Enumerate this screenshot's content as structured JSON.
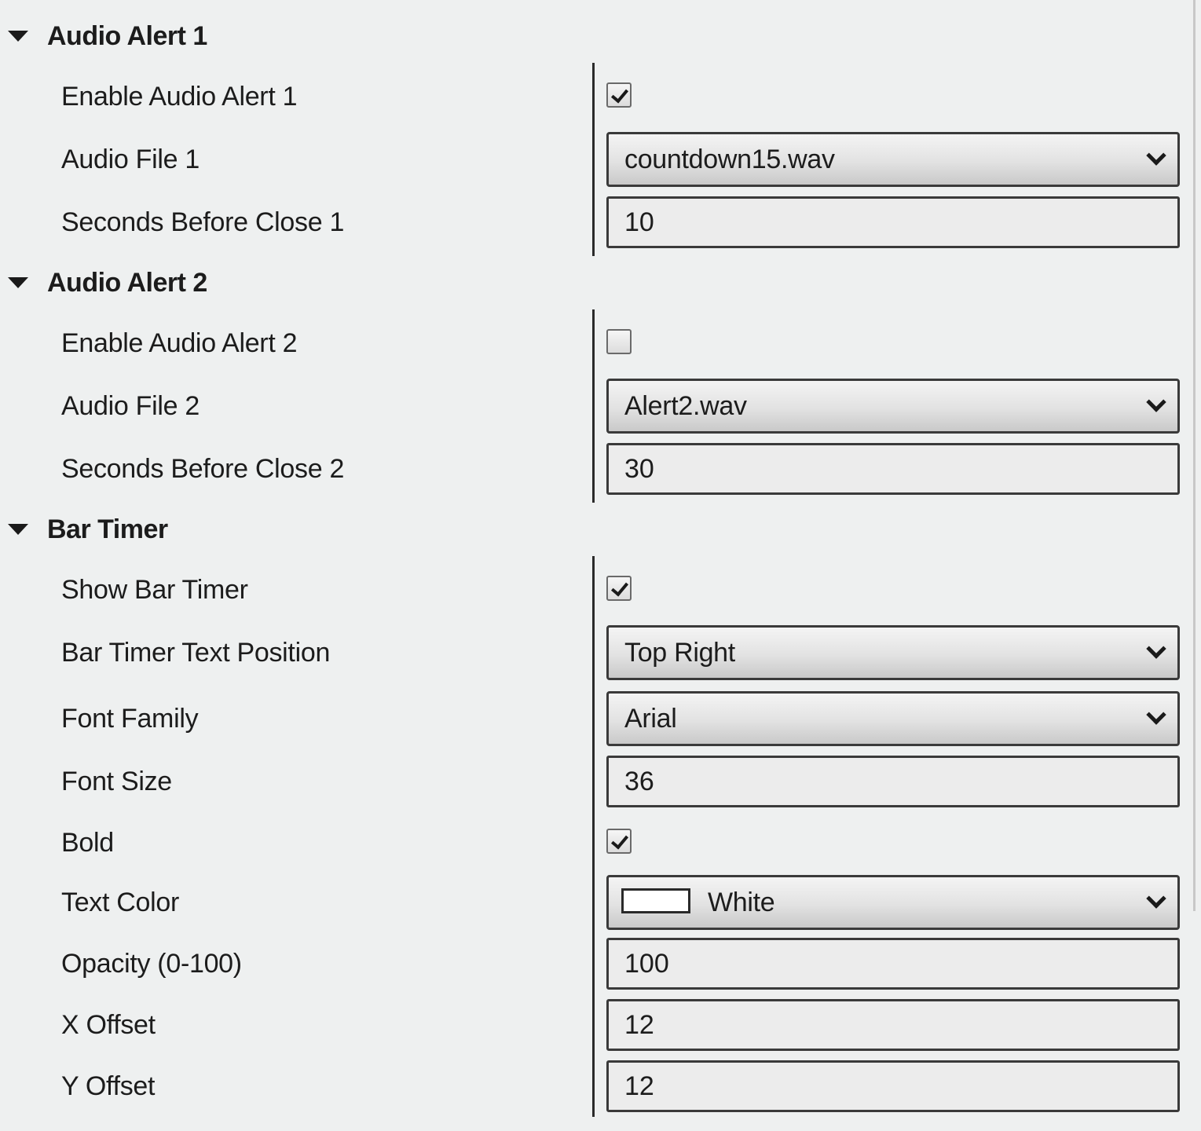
{
  "sections": [
    {
      "title": "Audio Alert 1",
      "rows": [
        {
          "label": "Enable Audio Alert 1",
          "type": "checkbox",
          "checked": true
        },
        {
          "label": "Audio File 1",
          "type": "select",
          "value": "countdown15.wav"
        },
        {
          "label": "Seconds Before Close 1",
          "type": "input",
          "value": "10"
        }
      ]
    },
    {
      "title": "Audio Alert 2",
      "rows": [
        {
          "label": "Enable Audio Alert 2",
          "type": "checkbox",
          "checked": false
        },
        {
          "label": "Audio File 2",
          "type": "select",
          "value": "Alert2.wav"
        },
        {
          "label": "Seconds Before Close 2",
          "type": "input",
          "value": "30"
        }
      ]
    },
    {
      "title": "Bar Timer",
      "rows": [
        {
          "label": "Show Bar Timer",
          "type": "checkbox",
          "checked": true
        },
        {
          "label": "Bar Timer Text Position",
          "type": "select",
          "value": "Top Right"
        },
        {
          "label": "Font Family",
          "type": "select",
          "value": "Arial"
        },
        {
          "label": "Font Size",
          "type": "input",
          "value": "36"
        },
        {
          "label": "Bold",
          "type": "checkbox",
          "checked": true
        },
        {
          "label": "Text Color",
          "type": "color-select",
          "value": "White",
          "swatch": "#ffffff"
        },
        {
          "label": "Opacity (0-100)",
          "type": "input",
          "value": "100"
        },
        {
          "label": "X Offset",
          "type": "input",
          "value": "12"
        },
        {
          "label": "Y Offset",
          "type": "input",
          "value": "12"
        }
      ]
    }
  ],
  "icons": {
    "section_toggle": "caret-down-icon",
    "dropdown": "chevron-down-icon",
    "check": "check-icon"
  }
}
